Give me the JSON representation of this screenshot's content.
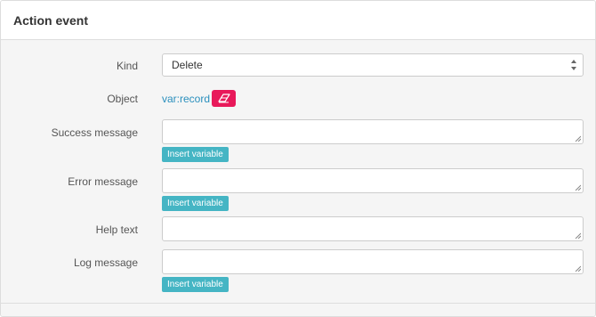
{
  "panel": {
    "title": "Action event"
  },
  "form": {
    "kind": {
      "label": "Kind",
      "value": "Delete"
    },
    "object": {
      "label": "Object",
      "value": "var:record"
    },
    "success_message": {
      "label": "Success message",
      "value": "",
      "insert_label": "Insert variable"
    },
    "error_message": {
      "label": "Error message",
      "value": "",
      "insert_label": "Insert variable"
    },
    "help_text": {
      "label": "Help text",
      "value": ""
    },
    "log_message": {
      "label": "Log message",
      "value": "",
      "insert_label": "Insert variable"
    }
  },
  "colors": {
    "accent_teal": "#45b5c4",
    "danger_pink": "#e8195a",
    "link_blue": "#2a8fbd"
  },
  "icons": {
    "select_arrows": "up-down-caret-icon",
    "eraser": "eraser-icon",
    "resize": "resize-grip-icon"
  }
}
